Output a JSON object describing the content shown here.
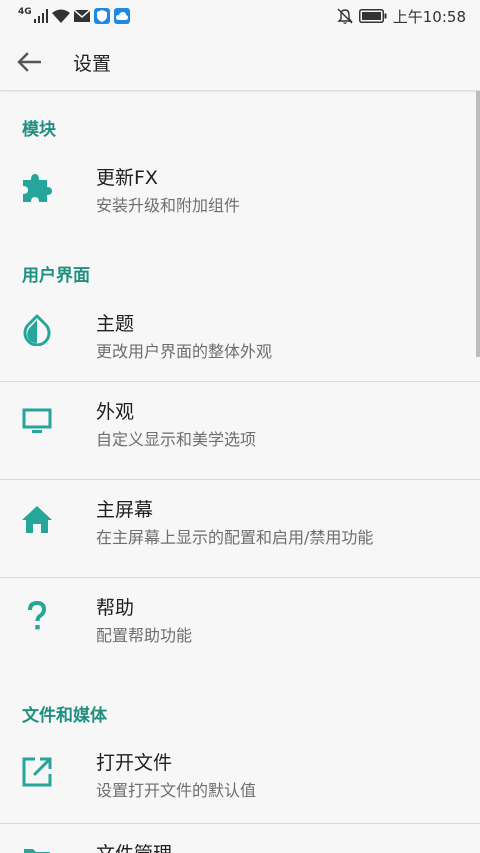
{
  "status_bar": {
    "network": "4G",
    "time": "上午10:58"
  },
  "app_bar": {
    "title": "设置"
  },
  "sections": [
    {
      "header": "模块",
      "items": [
        {
          "icon": "puzzle-icon",
          "title": "更新FX",
          "subtitle": "安装升级和附加组件"
        }
      ]
    },
    {
      "header": "用户界面",
      "items": [
        {
          "icon": "water-drop-icon",
          "title": "主题",
          "subtitle": "更改用户界面的整体外观"
        },
        {
          "icon": "monitor-icon",
          "title": "外观",
          "subtitle": "自定义显示和美学选项"
        },
        {
          "icon": "home-icon",
          "title": "主屏幕",
          "subtitle": "在主屏幕上显示的配置和启用/禁用功能"
        },
        {
          "icon": "question-icon",
          "title": "帮助",
          "subtitle": "配置帮助功能"
        }
      ]
    },
    {
      "header": "文件和媒体",
      "items": [
        {
          "icon": "open-external-icon",
          "title": "打开文件",
          "subtitle": "设置打开文件的默认值"
        },
        {
          "icon": "folder-icon",
          "title": "文件管理",
          "subtitle": ""
        }
      ]
    }
  ],
  "colors": {
    "accent": "#218f80",
    "icon": "#26a69a",
    "background": "#f7f7f7"
  }
}
